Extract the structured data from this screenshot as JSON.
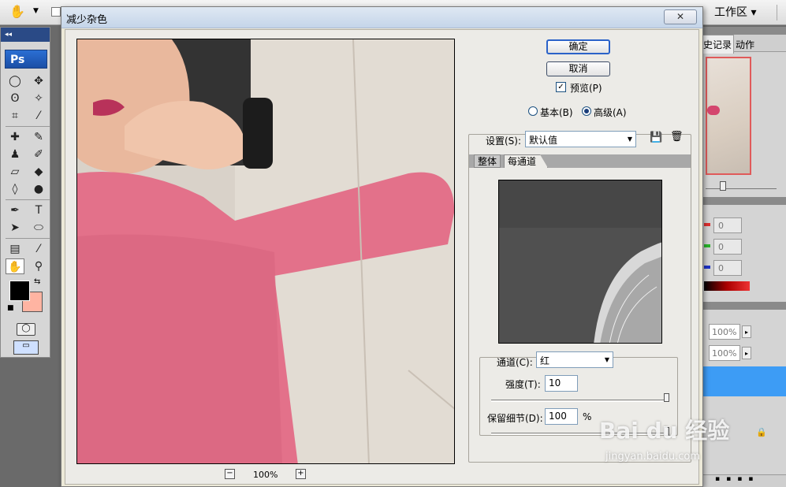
{
  "app": {
    "workspace_label": "工作区 ▾",
    "ps_logo": "Ps"
  },
  "dialog": {
    "title": "减少杂色",
    "close_label": "✕",
    "ok_label": "确定",
    "cancel_label": "取消",
    "preview_label": "预览(P)",
    "preview_checked": true,
    "mode_basic_label": "基本(B)",
    "mode_advanced_label": "高级(A)",
    "selected_mode": "advanced",
    "zoom_level": "100%",
    "settings": {
      "label": "设置(S):",
      "value": "默认值"
    },
    "tabs": [
      "整体",
      "每通道"
    ],
    "active_tab": "每通道",
    "channel": {
      "label": "通道(C):",
      "value": "红"
    },
    "strength": {
      "label": "强度(T):",
      "value": "10"
    },
    "preserve_details": {
      "label": "保留细节(D):",
      "value": "100",
      "unit": "%"
    }
  },
  "panels": {
    "history_tab": "史记录",
    "actions_tab": "动作",
    "color_fields": [
      "0",
      "0",
      "0"
    ],
    "zoom_fields": [
      "100%",
      "100%"
    ],
    "colors": {
      "red": "#e0302e",
      "green": "#2ab52a",
      "blue": "#1e33c8"
    }
  },
  "swatches": {
    "foreground": "#000000",
    "background": "#ffb4a2"
  },
  "watermark": {
    "logo_text": "Bai du 经验",
    "url": "jingyan.baidu.com"
  }
}
